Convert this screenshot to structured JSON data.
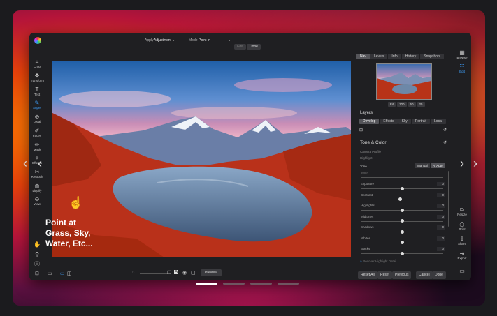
{
  "topbar": {
    "apply_label": "Apply",
    "apply_value": "Adjustment",
    "mode_label": "Mode",
    "mode_value": "Point In",
    "edit_btn": "Edit",
    "done_btn": "Done"
  },
  "left_tools": [
    {
      "label": "Crop",
      "icon": "crop-icon",
      "glyph": "⌗"
    },
    {
      "label": "Transform",
      "icon": "transform-icon",
      "glyph": "✥"
    },
    {
      "label": "Text",
      "icon": "text-icon",
      "glyph": "T"
    },
    {
      "label": "Super",
      "icon": "brush-icon",
      "glyph": "✎"
    },
    {
      "label": "Local",
      "icon": "local-icon",
      "glyph": "⊘"
    },
    {
      "label": "Faces",
      "icon": "faces-icon",
      "glyph": "✐"
    },
    {
      "label": "Mask",
      "icon": "mask-icon",
      "glyph": "✏"
    },
    {
      "label": "Effects",
      "icon": "effects-icon",
      "glyph": "✧"
    },
    {
      "label": "Retouch",
      "icon": "retouch-icon",
      "glyph": "✂"
    },
    {
      "label": "Liquify",
      "icon": "liquify-icon",
      "glyph": "◍"
    },
    {
      "label": "View",
      "icon": "view-icon",
      "glyph": "⊙"
    }
  ],
  "overlay": {
    "line1": "Point at",
    "line2": "Grass, Sky,",
    "line3": "Water, Etc..."
  },
  "right_tabs": [
    "Nav",
    "Levels",
    "Info",
    "History",
    "Snapshots"
  ],
  "zoom": [
    "Fit",
    "100",
    "50",
    "25"
  ],
  "layers_title": "Layers",
  "layer_tabs": [
    "Develop",
    "Effects",
    "Sky",
    "Portrait",
    "Local"
  ],
  "tone": {
    "title": "Tone & Color",
    "profile_label": "Camera Profile",
    "profile_value": "Highlight",
    "tone_label": "Tone",
    "manual_btn": "Manual",
    "ai_btn": "AI Auto",
    "hint": "Tone",
    "sliders": [
      {
        "label": "Exposure",
        "value": "0",
        "pos": 0.5
      },
      {
        "label": "Contrast",
        "value": "0",
        "pos": 0.48
      },
      {
        "label": "Highlights",
        "value": "0",
        "pos": 0.5
      },
      {
        "label": "Midtones",
        "value": "0",
        "pos": 0.5
      },
      {
        "label": "Shadows",
        "value": "0",
        "pos": 0.5
      },
      {
        "label": "Whites",
        "value": "0",
        "pos": 0.5
      },
      {
        "label": "Blacks",
        "value": "0",
        "pos": 0.5
      }
    ],
    "recover": "Recover Highlight Detail"
  },
  "bottom_buttons": [
    "Reset All",
    "Reset",
    "Previous",
    "Cancel",
    "Done"
  ],
  "preview_btn": "Preview",
  "right_strip": [
    {
      "label": "Browse",
      "icon": "browse-icon",
      "glyph": "▦"
    },
    {
      "label": "Edit",
      "icon": "edit-icon",
      "glyph": "☷"
    },
    {
      "label": "Resize",
      "icon": "resize-icon",
      "glyph": "⧉"
    },
    {
      "label": "Print",
      "icon": "print-icon",
      "glyph": "⎙"
    },
    {
      "label": "Share",
      "icon": "share-icon",
      "glyph": "⇪"
    },
    {
      "label": "Export",
      "icon": "export-icon",
      "glyph": "⇥"
    }
  ],
  "colors": {
    "accent": "#3fa2ff"
  }
}
